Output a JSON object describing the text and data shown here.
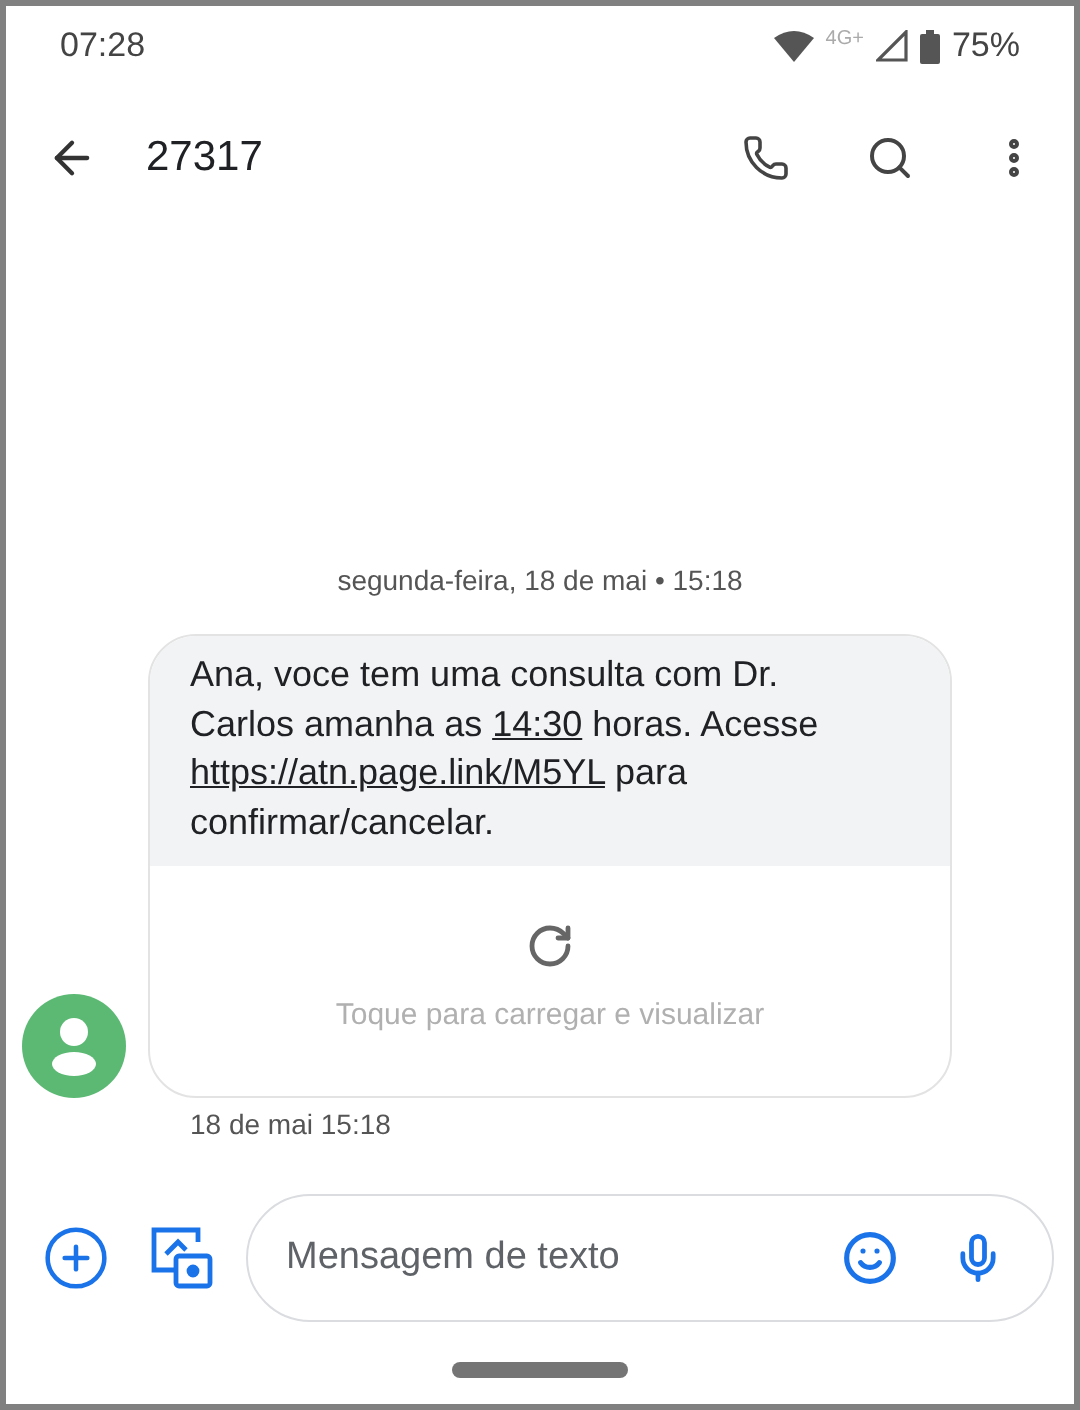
{
  "status_bar": {
    "time": "07:28",
    "network": "4G+",
    "battery": "75%"
  },
  "toolbar": {
    "title": "27317"
  },
  "date_separator": "segunda-feira, 18 de mai • 15:18",
  "message": {
    "parts": [
      {
        "kind": "text",
        "text": "Ana, voce tem uma consulta com Dr. Carlos amanha as "
      },
      {
        "kind": "link",
        "text": "14:30"
      },
      {
        "kind": "text",
        "text": " horas. Acesse "
      },
      {
        "kind": "link",
        "text": "https://atn.page.link/M5YL"
      },
      {
        "kind": "text",
        "text": " para confirmar/cancelar."
      }
    ],
    "preview_hint": "Toque para carregar e visualizar",
    "timestamp": "18 de mai 15:18"
  },
  "compose": {
    "placeholder": "Mensagem de texto"
  }
}
